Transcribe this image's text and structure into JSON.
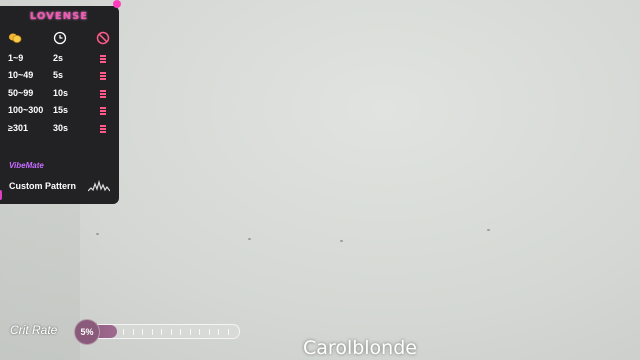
{
  "panel": {
    "logo": "LOVENSE",
    "header_icons": [
      "coin-icon",
      "clock-icon",
      "stop-icon"
    ],
    "tiers": [
      {
        "range": "1~9",
        "time": "2s"
      },
      {
        "range": "10~49",
        "time": "5s"
      },
      {
        "range": "50~99",
        "time": "10s"
      },
      {
        "range": "100~300",
        "time": "15s"
      },
      {
        "range": "≥301",
        "time": "30s"
      }
    ],
    "vibemate": "VibeMate",
    "custom_pattern": "Custom Pattern"
  },
  "crit": {
    "label": "Crit Rate",
    "value_text": "5%",
    "value": 0.05
  },
  "overlay": {
    "username": "Carolblonde"
  },
  "colors": {
    "panel_bg": "#121216",
    "logo_pink": "#f05ab4",
    "vibemate_purple": "#c76cff",
    "bar_red": "#ff5a8a",
    "crit_knob": "#8a5a7a"
  }
}
